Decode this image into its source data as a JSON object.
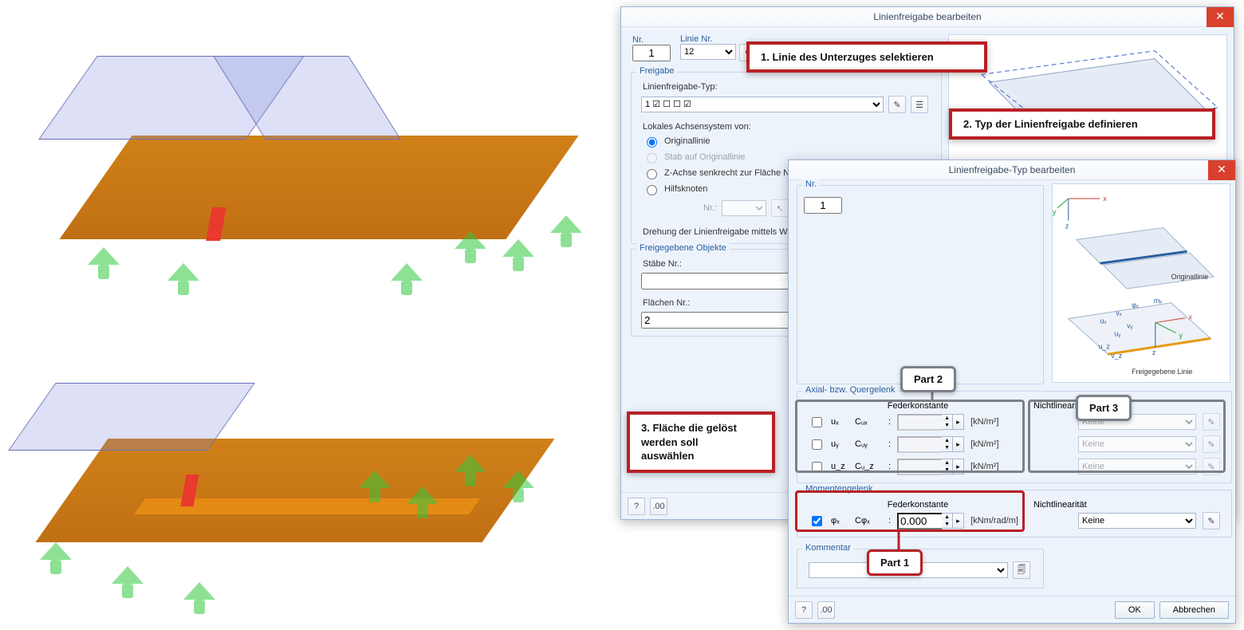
{
  "dialog1": {
    "title": "Linienfreigabe bearbeiten",
    "nr_label": "Nr.",
    "nr_value": "1",
    "linie_nr_label": "Linie Nr.",
    "linie_nr_value": "12",
    "freigabe_section": "Freigabe",
    "typ_label": "Linienfreigabe-Typ:",
    "typ_value": "1   ☑ ☐ ☐   ☑",
    "achsensystem_label": "Lokales Achsensystem von:",
    "radio_original": "Originallinie",
    "radio_stab": "Stab auf Originallinie",
    "radio_zachse": "Z-Achse senkrecht zur Fläche Nr.:",
    "radio_hilfs": "Hilfsknoten",
    "nr_small": "Nr.:",
    "drehung_label": "Drehung der Linienfreigabe mittels Winkel",
    "freigegebene_section": "Freigegebene Objekte",
    "staebe_label": "Stäbe Nr.:",
    "staebe_value": "",
    "flaechen_label": "Flächen Nr.:",
    "flaechen_value": "2"
  },
  "dialog2": {
    "title": "Linienfreigabe-Typ bearbeiten",
    "nr_label": "Nr.",
    "nr_value": "1",
    "preview_labels": {
      "original": "Originallinie",
      "freigegebene": "Freigegebene Linie"
    },
    "axial_section": "Axial- bzw. Quergelenk",
    "federkonstante_hdr": "Federkonstante",
    "nichtlinearitaet_hdr": "Nichtlinearität",
    "rows": [
      {
        "sym": "uₓ",
        "c": "Cᵤₓ",
        "unit": "[kN/m²]",
        "nonlin": "Keine"
      },
      {
        "sym": "uᵧ",
        "c": "Cᵤᵧ",
        "unit": "[kN/m²]",
        "nonlin": "Keine"
      },
      {
        "sym": "u_z",
        "c": "Cᵤ_z",
        "unit": "[kN/m²]",
        "nonlin": "Keine"
      }
    ],
    "moment_section": "Momentengelenk",
    "moment_row": {
      "sym": "φₓ",
      "c": "Cφₓ",
      "val": "0.000",
      "unit": "[kNm/rad/m]",
      "nonlin": "Keine"
    },
    "kommentar_section": "Kommentar",
    "ok": "OK",
    "cancel": "Abbrechen"
  },
  "callouts": {
    "c1": "1. Linie des Unterzuges selektieren",
    "c2": "2. Typ der Linienfreigabe definieren",
    "c3_l1": "3. Fläche die gelöst",
    "c3_l2": "werden soll",
    "c3_l3": "auswählen",
    "p1": "Part 1",
    "p2": "Part 2",
    "p3": "Part 3"
  }
}
